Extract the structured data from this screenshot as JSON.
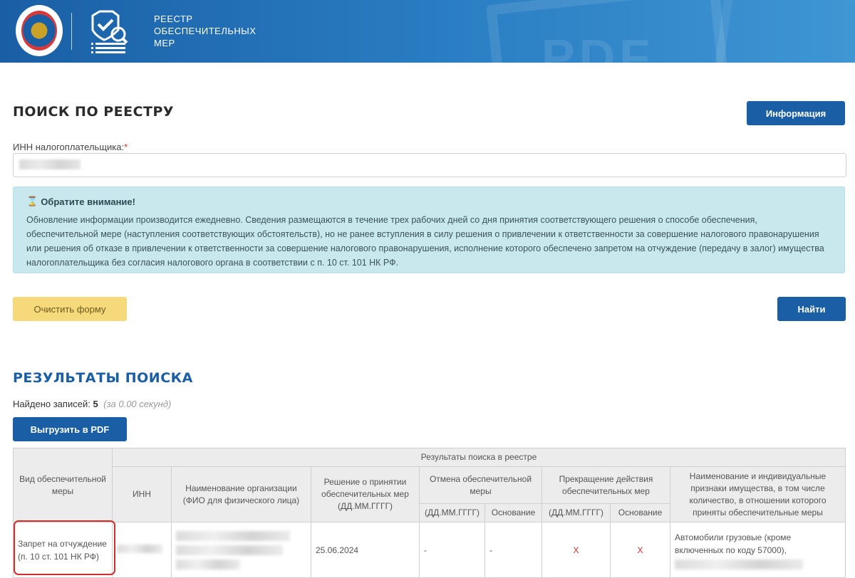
{
  "header": {
    "title_lines": [
      "РЕЕСТР",
      "ОБЕСПЕЧИТЕЛЬНЫХ",
      "МЕР"
    ],
    "watermark": "PDF"
  },
  "search": {
    "title": "ПОИСК ПО РЕЕСТРУ",
    "info_button": "Информация",
    "inn_label": "ИНН налогоплательщика:",
    "inn_required": "*",
    "inn_value": ""
  },
  "alert": {
    "title": "Обратите внимание!",
    "body": "Обновление информации производится ежедневно. Сведения размещаются в течение трех рабочих дней со дня принятия соответствующего решения о способе обеспечения, обеспечительной мере (наступления соответствующих обстоятельств), но не ранее вступления в силу решения о привлечении к ответственности за совершение налогового правонарушения или решения об отказе в привлечении к ответственности за совершение налогового правонарушения, исполнение которого обеспечено запретом на отчуждение (передачу в залог) имущества налогоплательщика без согласия налогового органа в соответствии с п. 10 ст. 101 НК РФ."
  },
  "buttons": {
    "clear": "Очистить форму",
    "find": "Найти",
    "export_pdf": "Выгрузить в PDF"
  },
  "results": {
    "title": "РЕЗУЛЬТАТЫ ПОИСКА",
    "found_label": "Найдено записей:",
    "found_count": "5",
    "found_time": "(за 0.00 секунд)",
    "table": {
      "col_kind": "Вид обеспечительной меры",
      "group_header": "Результаты поиска в реестре",
      "col_inn": "ИНН",
      "col_org": "Наименование организации (ФИО для физического лица)",
      "col_decision": "Решение о принятии обеспечительных мер (ДД.ММ.ГГГГ)",
      "col_cancel": "Отмена обеспечительной меры",
      "col_stop": "Прекращение действия обеспечительных мер",
      "col_property": "Наименование и индивидуальные признаки имущества, в том числе количество, в отношении которого приняты обеспечительные меры",
      "sub_date": "(ДД.ММ.ГГГГ)",
      "sub_basis": "Основание",
      "rows": [
        {
          "kind": "Запрет на отчуждение (п. 10 ст. 101 НК РФ)",
          "decision_date": "25.06.2024",
          "cancel_date": "-",
          "cancel_basis": "-",
          "stop_date": "X",
          "stop_basis": "X",
          "property": "Автомобили грузовые (кроме включенных по коду 57000),"
        }
      ]
    }
  },
  "colors": {
    "header_blue": "#1a5fa6",
    "button_blue": "#1a5fa6",
    "clear_yellow": "#f5d97a",
    "alert_bg": "#c9e8ee",
    "highlight_red": "#d62b2b"
  }
}
